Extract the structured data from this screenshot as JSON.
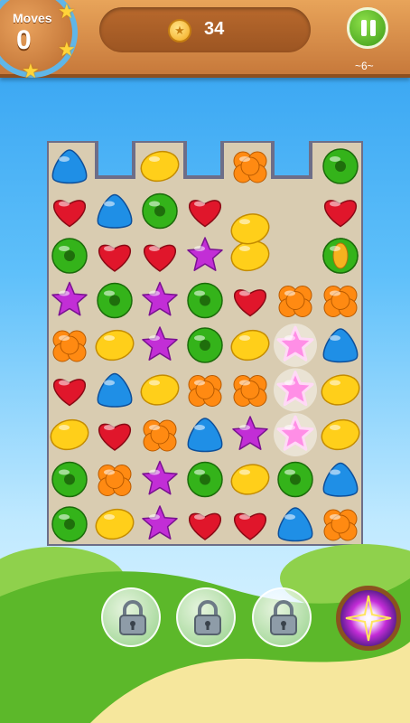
{
  "hud": {
    "moves_label": "Moves",
    "moves_value": "0",
    "stars_earned": 3,
    "coins": "34",
    "level": "~6~"
  },
  "board": {
    "columns": 7,
    "rows": 9,
    "grid": [
      [
        "blue-drop",
        "",
        "yellow-lemon",
        "",
        "orange-cluster",
        "",
        "green-donut"
      ],
      [
        "red-heart",
        "blue-drop",
        "green-donut",
        "red-heart",
        "",
        "",
        "red-heart"
      ],
      [
        "green-donut",
        "red-heart",
        "red-heart",
        "purple-star",
        "yellow-lemon",
        "",
        "green-donut"
      ],
      [
        "purple-star",
        "green-donut",
        "purple-star",
        "green-donut",
        "red-heart",
        "orange-cluster",
        "orange-cluster"
      ],
      [
        "orange-cluster",
        "yellow-lemon",
        "purple-star",
        "green-donut",
        "yellow-lemon",
        "pink-star",
        "blue-drop"
      ],
      [
        "red-heart",
        "blue-drop",
        "yellow-lemon",
        "orange-cluster",
        "orange-cluster",
        "pink-star",
        "yellow-lemon"
      ],
      [
        "yellow-lemon",
        "red-heart",
        "orange-cluster",
        "blue-drop",
        "purple-star",
        "pink-star",
        "yellow-lemon"
      ],
      [
        "green-donut",
        "orange-cluster",
        "purple-star",
        "green-donut",
        "yellow-lemon",
        "green-donut",
        "blue-drop"
      ],
      [
        "green-donut",
        "yellow-lemon",
        "purple-star",
        "red-heart",
        "red-heart",
        "blue-drop",
        "orange-cluster"
      ]
    ],
    "falling": [
      {
        "type": "yellow-lemon",
        "col": 4,
        "row": 1.4
      },
      {
        "type": "coin-candy",
        "col": 6,
        "row": 2.0
      }
    ]
  },
  "boosters": [
    {
      "name": "locked-booster-1",
      "state": "locked"
    },
    {
      "name": "locked-booster-2",
      "state": "locked"
    },
    {
      "name": "locked-booster-3",
      "state": "locked"
    },
    {
      "name": "color-bomb-booster",
      "state": "available"
    }
  ],
  "colors": {
    "red-heart": "#e0162b",
    "blue-drop": "#1f8fe6",
    "yellow-lemon": "#ffcf1a",
    "green-donut": "#34b31a",
    "purple-star": "#c22ed6",
    "orange-cluster": "#ff8a12",
    "pink-star": "#ff8ee6",
    "coin-candy": "#f6b21f"
  }
}
